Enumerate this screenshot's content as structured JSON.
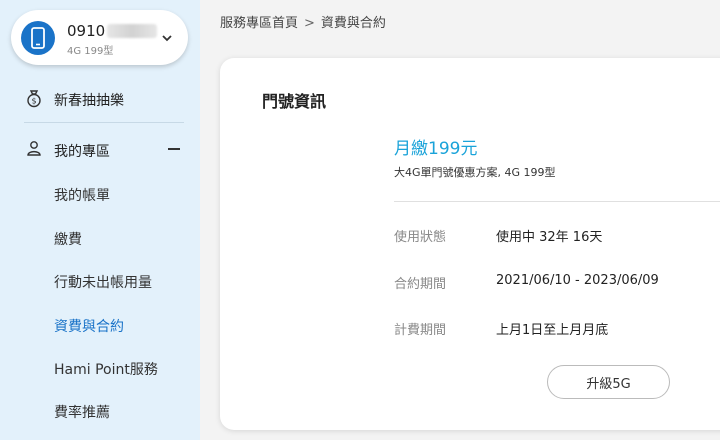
{
  "account": {
    "number_prefix": "0910",
    "plan": "4G 199型"
  },
  "sidebar": {
    "lottery_label": "新春抽抽樂",
    "my_zone_label": "我的專區",
    "items": [
      {
        "label": "我的帳單"
      },
      {
        "label": "繳費"
      },
      {
        "label": "行動未出帳用量"
      },
      {
        "label": "資費與合約"
      },
      {
        "label": "Hami Point服務"
      },
      {
        "label": "費率推薦"
      }
    ]
  },
  "breadcrumb": {
    "home": "服務專區首頁",
    "separator": ">",
    "current": "資費與合約"
  },
  "card": {
    "title": "門號資訊",
    "monthly_fee": "月繳199元",
    "plan_name": "大4G單門號優惠方案, 4G 199型",
    "rows": [
      {
        "label": "使用狀態",
        "value": "使用中 32年 16天"
      },
      {
        "label": "合約期間",
        "value": "2021/06/10 - 2023/06/09"
      },
      {
        "label": "計費期間",
        "value": "上月1日至上月月底"
      }
    ],
    "upgrade_label": "升級5G"
  },
  "colors": {
    "accent": "#1a73c8",
    "fee": "#1aa3d9",
    "sidebar_bg": "#e3f1fb"
  },
  "icons": [
    "phone-icon",
    "chevron-down-icon",
    "money-bag-icon",
    "user-icon",
    "minus-icon"
  ]
}
